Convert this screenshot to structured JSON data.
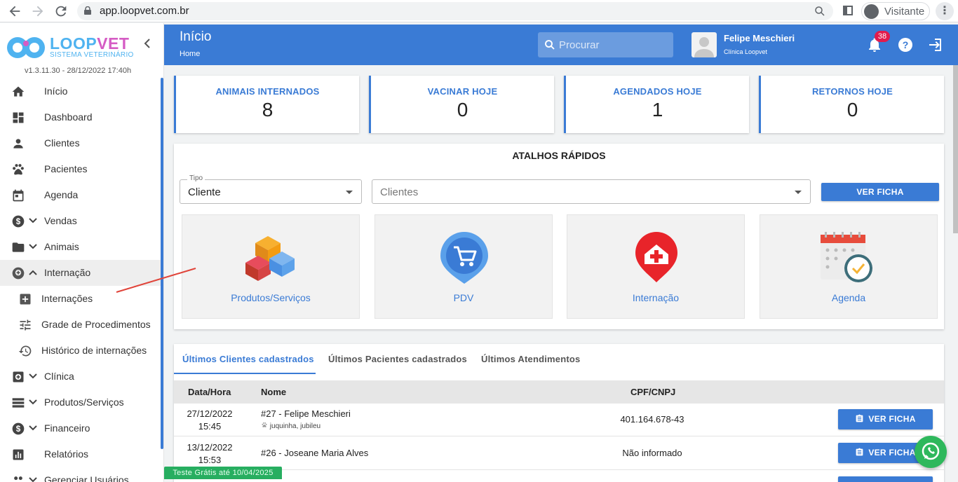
{
  "browser": {
    "url": "app.loopvet.com.br",
    "profile_label": "Visitante"
  },
  "sidebar": {
    "brand_part1": "LOOP",
    "brand_part2": "VET",
    "brand_sub": "SISTEMA VETERINÁRIO",
    "version": "v1.3.11.30 - 28/12/2022 17:40h",
    "items": [
      {
        "label": "Início"
      },
      {
        "label": "Dashboard"
      },
      {
        "label": "Clientes"
      },
      {
        "label": "Pacientes"
      },
      {
        "label": "Agenda"
      },
      {
        "label": "Vendas"
      },
      {
        "label": "Animais"
      },
      {
        "label": "Internação"
      },
      {
        "label": "Internações"
      },
      {
        "label": "Grade de Procedimentos"
      },
      {
        "label": "Histórico de internações"
      },
      {
        "label": "Clínica"
      },
      {
        "label": "Produtos/Serviços"
      },
      {
        "label": "Financeiro"
      },
      {
        "label": "Relatórios"
      },
      {
        "label": "Gerenciar Usuários"
      }
    ]
  },
  "header": {
    "title": "Início",
    "breadcrumb": "Home",
    "search_placeholder": "Procurar",
    "user_name": "Felipe Meschieri",
    "user_clinic": "Clínica Loopvet",
    "notifications_count": "38"
  },
  "stats": [
    {
      "title": "ANIMAIS INTERNADOS",
      "value": "8"
    },
    {
      "title": "VACINAR HOJE",
      "value": "0"
    },
    {
      "title": "AGENDADOS HOJE",
      "value": "1"
    },
    {
      "title": "RETORNOS HOJE",
      "value": "0"
    }
  ],
  "shortcuts": {
    "title": "ATALHOS RÁPIDOS",
    "tipo_label": "Tipo",
    "tipo_value": "Cliente",
    "clientes_placeholder": "Clientes",
    "ver_ficha": "VER FICHA",
    "tiles": [
      {
        "label": "Produtos/Serviços",
        "icon": "cubes-icon"
      },
      {
        "label": "PDV",
        "icon": "cart-icon"
      },
      {
        "label": "Internação",
        "icon": "hospital-icon"
      },
      {
        "label": "Agenda",
        "icon": "calendar-icon"
      }
    ]
  },
  "recent": {
    "tabs": [
      {
        "label": "Últimos Clientes cadastrados"
      },
      {
        "label": "Últimos Pacientes cadastrados"
      },
      {
        "label": "Últimos Atendimentos"
      }
    ],
    "columns": [
      "Data/Hora",
      "Nome",
      "CPF/CNPJ"
    ],
    "rows": [
      {
        "date": "27/12/2022",
        "time": "15:45",
        "name": "#27 - Felipe Meschieri",
        "pets": "juquinha, jubileu",
        "cpf": "401.164.678-43",
        "action": "VER FICHA"
      },
      {
        "date": "13/12/2022",
        "time": "15:53",
        "name": "#26 - Joseane Maria Alves",
        "pets": "",
        "cpf": "Não informado",
        "action": "VER FICHA"
      }
    ]
  },
  "trial_banner": "Teste Grátis até 10/04/2025",
  "colors": {
    "primary": "#3a7bd5",
    "badge": "#e21b4d",
    "trial": "#27ae60",
    "whatsapp": "#2eb85c",
    "annotation": "#e0443a"
  }
}
